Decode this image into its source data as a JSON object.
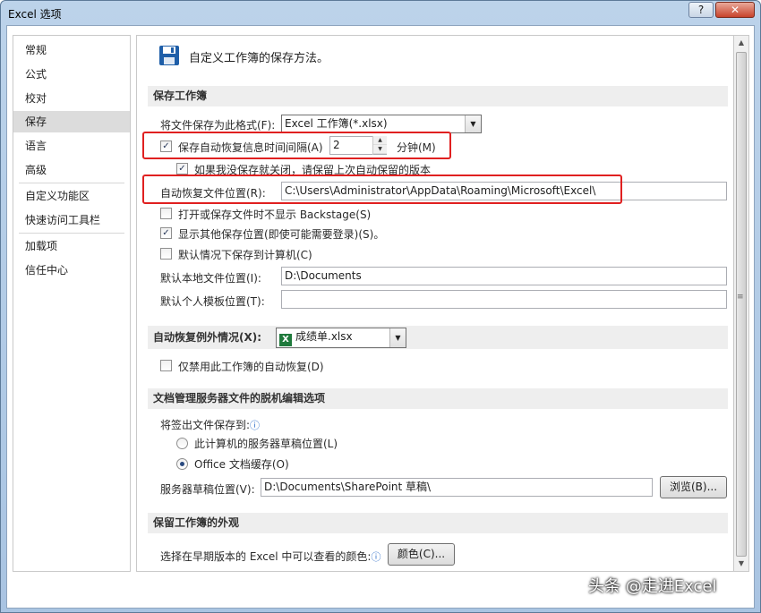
{
  "window": {
    "title": "Excel 选项",
    "help_label": "?",
    "close_label": "✕"
  },
  "nav": {
    "items": [
      {
        "label": "常规"
      },
      {
        "label": "公式"
      },
      {
        "label": "校对"
      },
      {
        "label": "保存"
      },
      {
        "label": "语言"
      },
      {
        "label": "高级"
      },
      {
        "label": "自定义功能区"
      },
      {
        "label": "快速访问工具栏"
      },
      {
        "label": "加载项"
      },
      {
        "label": "信任中心"
      }
    ],
    "active": "保存"
  },
  "header": {
    "text": "自定义工作簿的保存方法。"
  },
  "save_section": {
    "title": "保存工作簿",
    "format_label": "将文件保存为此格式(F):",
    "format_value": "Excel 工作簿(*.xlsx)",
    "autorecover_label": "保存自动恢复信息时间间隔(A)",
    "autorecover_checked": true,
    "interval_value": "2",
    "minutes_label": "分钟(M)",
    "keep_last_label": "如果我没保存就关闭，请保留上次自动保留的版本",
    "keep_last_checked": true,
    "autorecover_location_label": "自动恢复文件位置(R):",
    "autorecover_location_value": "C:\\Users\\Administrator\\AppData\\Roaming\\Microsoft\\Excel\\",
    "no_backstage_label": "打开或保存文件时不显示 Backstage(S)",
    "no_backstage_checked": false,
    "show_other_label": "显示其他保存位置(即使可能需要登录)(S)。",
    "show_other_checked": true,
    "default_computer_label": "默认情况下保存到计算机(C)",
    "default_computer_checked": false,
    "local_path_label": "默认本地文件位置(I):",
    "local_path_value": "D:\\Documents",
    "template_label": "默认个人模板位置(T):",
    "template_value": ""
  },
  "exceptions_section": {
    "title": "自动恢复例外情况(X):",
    "workbook_value": "成绩单.xlsx",
    "disable_label": "仅禁用此工作簿的自动恢复(D)",
    "disable_checked": false
  },
  "offline_section": {
    "title": "文档管理服务器文件的脱机编辑选项",
    "save_to_label": "将签出文件保存到:",
    "radio_server_label": "此计算机的服务器草稿位置(L)",
    "radio_cache_label": "Office 文档缓存(O)",
    "selected": "Office 文档缓存(O)",
    "drafts_label": "服务器草稿位置(V):",
    "drafts_value": "D:\\Documents\\SharePoint 草稿\\",
    "browse_label": "浏览(B)..."
  },
  "appearance_section": {
    "title": "保留工作簿的外观",
    "colors_label": "选择在早期版本的 Excel 中可以查看的颜色:",
    "colors_button": "颜色(C)..."
  },
  "watermark": "头条 @走进Excel",
  "icons": {
    "save": "floppy-disk-icon",
    "info": "info-icon",
    "excel_file": "excel-file-icon",
    "dropdown": "chevron-down-icon"
  },
  "colors": {
    "highlight": "#e02020",
    "title_bar": "#bcd3ea",
    "save_icon": "#1e5ea8"
  }
}
